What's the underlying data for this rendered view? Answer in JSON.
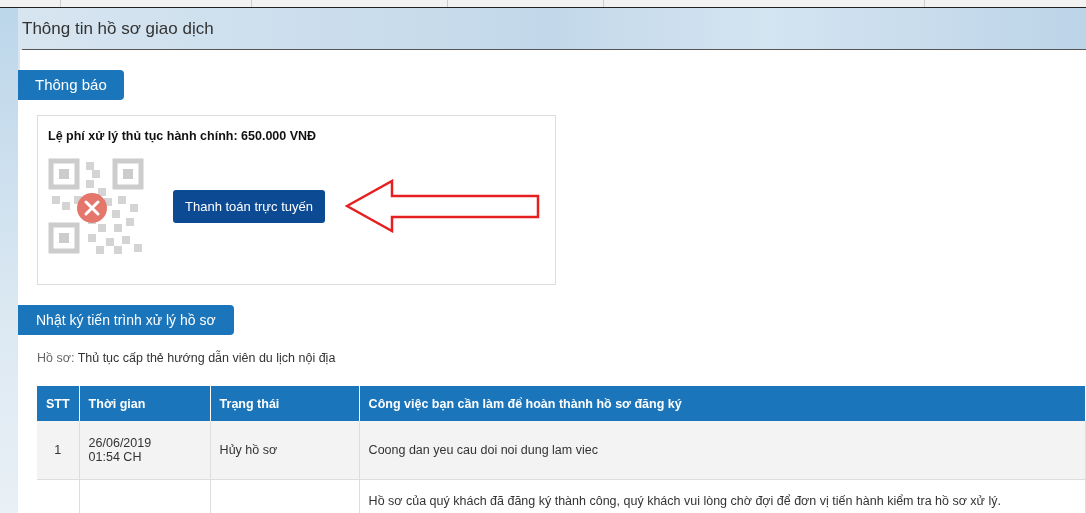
{
  "page_title": "Thông tin hồ sơ giao dịch",
  "notice": {
    "heading": "Thông báo",
    "fee": "Lệ phí xử lý thủ tục hành chính: 650.000 VNĐ",
    "qr_error": true,
    "pay_button": "Thanh toán trực tuyến"
  },
  "log": {
    "heading": "Nhật ký tiến trình xử lý hồ sơ",
    "record_label": "Hồ sơ:",
    "record_value": "Thủ tục cấp thẻ hướng dẫn viên du lịch nội địa"
  },
  "table": {
    "columns": [
      "STT",
      "Thời gian",
      "Trạng thái",
      "Công việc bạn cần làm để hoàn thành hồ sơ đăng ký"
    ],
    "rows": [
      {
        "stt": "1",
        "time": "26/06/2019\n01:54 CH",
        "status": "Hủy hồ sơ",
        "task": "Coong dan yeu cau doi noi dung lam viec"
      },
      {
        "task": "Hồ sơ của quý khách đã đăng ký thành công, quý khách vui lòng chờ đợi để đơn vị tiến hành kiểm tra hồ sơ xử lý."
      }
    ]
  }
}
